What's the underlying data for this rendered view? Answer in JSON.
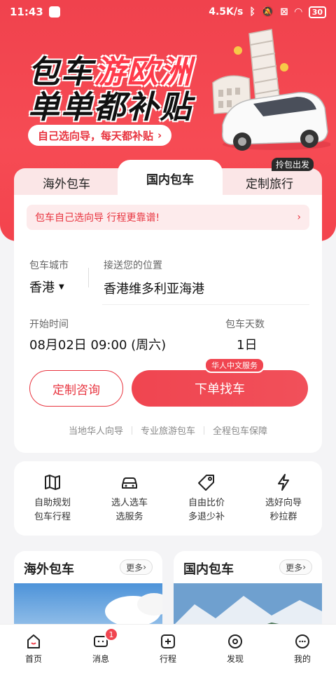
{
  "status_bar": {
    "time": "11:43",
    "speed": "4.5K/s",
    "battery": "30"
  },
  "hero": {
    "title_line1_a": "包车",
    "title_line1_b": "游欧洲",
    "title_line2": "单单都补贴",
    "pill": "自己选向导，每天都补贴"
  },
  "tabs": {
    "left": "海外包车",
    "active": "国内包车",
    "right": "定制旅行",
    "right_badge": "拎包出发"
  },
  "booking": {
    "notice": "包车自己选向导 行程更靠谱!",
    "city_label": "包车城市",
    "city_value": "香港",
    "pickup_label": "接送您的位置",
    "pickup_value": "香港维多利亚海港",
    "start_label": "开始时间",
    "start_value": "08月02日 09:00 (周六)",
    "days_label": "包车天数",
    "days_value": "1日",
    "consult_button": "定制咨询",
    "order_button": "下单找车",
    "order_badge": "华人中文服务",
    "features": [
      "当地华人向导",
      "专业旅游包车",
      "全程包车保障"
    ]
  },
  "services": [
    {
      "line1": "自助规划",
      "line2": "包车行程",
      "icon": "map-icon"
    },
    {
      "line1": "选人选车",
      "line2": "选服务",
      "icon": "car-icon"
    },
    {
      "line1": "自由比价",
      "line2": "多退少补",
      "icon": "tag-icon"
    },
    {
      "line1": "选好向导",
      "line2": "秒拉群",
      "icon": "lightning-icon"
    }
  ],
  "cards": {
    "left_title": "海外包车",
    "right_title": "国内包车",
    "more": "更多"
  },
  "nav": {
    "home": "首页",
    "messages": "消息",
    "messages_badge": "1",
    "trips": "行程",
    "discover": "发现",
    "mine": "我的"
  },
  "colors": {
    "brand": "#f04550",
    "brand_light": "#fdebec"
  }
}
